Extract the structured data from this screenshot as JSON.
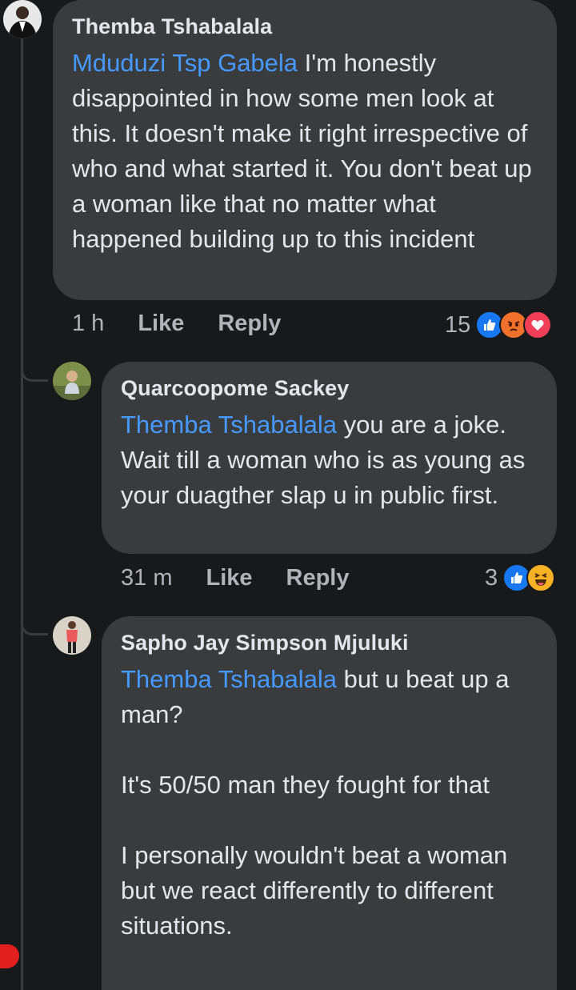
{
  "comments": [
    {
      "author": "Themba Tshabalala",
      "mention": "Mduduzi Tsp Gabela",
      "text": " I'm honestly disappointed in how some men look at this. It doesn't make it right irrespective of who and what started it. You don't beat up a woman like that no matter what happened building up to this incident",
      "time": "1 h",
      "like": "Like",
      "reply": "Reply",
      "reaction_count": "15",
      "reactions": [
        "like-icon",
        "angry-icon",
        "love-icon"
      ]
    },
    {
      "author": "Quarcoopome Sackey",
      "mention": "Themba Tshabalala",
      "text": " you are a joke. Wait till a woman who is as young as your duagther slap u in public first.",
      "time": "31 m",
      "like": "Like",
      "reply": "Reply",
      "reaction_count": "3",
      "reactions": [
        "like-icon",
        "haha-icon"
      ]
    },
    {
      "author": "Sapho Jay Simpson Mjuluki",
      "mention": "Themba Tshabalala",
      "text": " but u beat up a man?\n\nIt's 50/50 man they fought for that\n\nI personally wouldn't beat a woman but we react differently to different situations."
    }
  ],
  "colors": {
    "background": "#18191a",
    "bubble": "#3a3b3c",
    "mention": "#4599ff",
    "like": "#1877f2",
    "angry": "#f0712c",
    "love": "#f33e58",
    "haha": "#f7b125"
  }
}
